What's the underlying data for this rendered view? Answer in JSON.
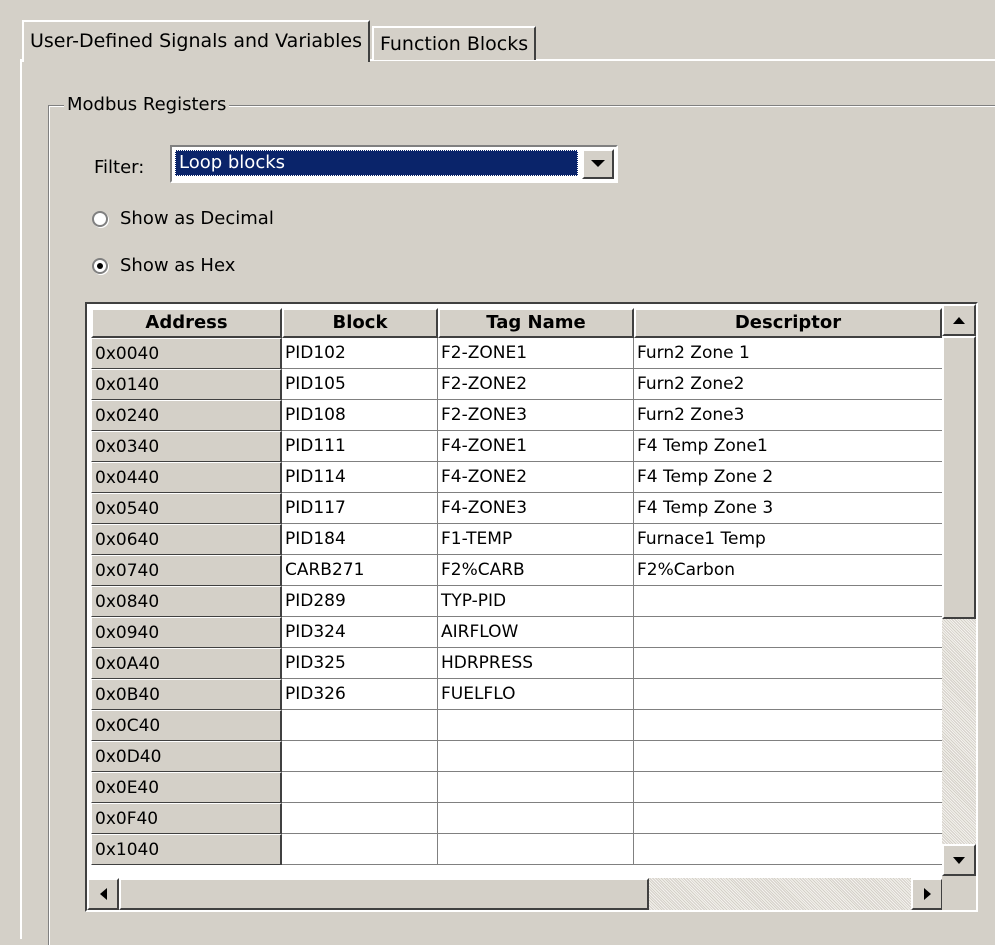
{
  "tabs": [
    {
      "label": "User-Defined Signals and Variables"
    },
    {
      "label": "Function Blocks"
    }
  ],
  "group": {
    "title": "Modbus Registers"
  },
  "filter": {
    "label": "Filter:",
    "value": "Loop blocks"
  },
  "radios": [
    {
      "label": "Show as Decimal",
      "checked": false
    },
    {
      "label": "Show as Hex",
      "checked": true
    }
  ],
  "grid": {
    "columns": [
      "Address",
      "Block",
      "Tag Name",
      "Descriptor"
    ],
    "rows": [
      {
        "address": "0x0040",
        "block": "PID102",
        "tag": "F2-ZONE1",
        "descriptor": "Furn2 Zone 1"
      },
      {
        "address": "0x0140",
        "block": "PID105",
        "tag": "F2-ZONE2",
        "descriptor": "Furn2 Zone2"
      },
      {
        "address": "0x0240",
        "block": "PID108",
        "tag": "F2-ZONE3",
        "descriptor": "Furn2 Zone3"
      },
      {
        "address": "0x0340",
        "block": "PID111",
        "tag": "F4-ZONE1",
        "descriptor": "F4 Temp Zone1"
      },
      {
        "address": "0x0440",
        "block": "PID114",
        "tag": "F4-ZONE2",
        "descriptor": "F4 Temp Zone 2"
      },
      {
        "address": "0x0540",
        "block": "PID117",
        "tag": "F4-ZONE3",
        "descriptor": "F4 Temp Zone 3"
      },
      {
        "address": "0x0640",
        "block": "PID184",
        "tag": "F1-TEMP",
        "descriptor": "Furnace1 Temp"
      },
      {
        "address": "0x0740",
        "block": "CARB271",
        "tag": "F2%CARB",
        "descriptor": "F2%Carbon"
      },
      {
        "address": "0x0840",
        "block": "PID289",
        "tag": "TYP-PID",
        "descriptor": ""
      },
      {
        "address": "0x0940",
        "block": "PID324",
        "tag": "AIRFLOW",
        "descriptor": ""
      },
      {
        "address": "0x0A40",
        "block": "PID325",
        "tag": "HDRPRESS",
        "descriptor": ""
      },
      {
        "address": "0x0B40",
        "block": "PID326",
        "tag": "FUELFLO",
        "descriptor": ""
      },
      {
        "address": "0x0C40",
        "block": "",
        "tag": "",
        "descriptor": ""
      },
      {
        "address": "0x0D40",
        "block": "",
        "tag": "",
        "descriptor": ""
      },
      {
        "address": "0x0E40",
        "block": "",
        "tag": "",
        "descriptor": ""
      },
      {
        "address": "0x0F40",
        "block": "",
        "tag": "",
        "descriptor": ""
      },
      {
        "address": "0x1040",
        "block": "",
        "tag": "",
        "descriptor": ""
      }
    ]
  },
  "icons": {
    "dropdown": "chevron-down-icon",
    "scroll_up": "arrow-up-icon",
    "scroll_down": "arrow-down-icon",
    "scroll_left": "arrow-left-icon",
    "scroll_right": "arrow-right-icon"
  }
}
